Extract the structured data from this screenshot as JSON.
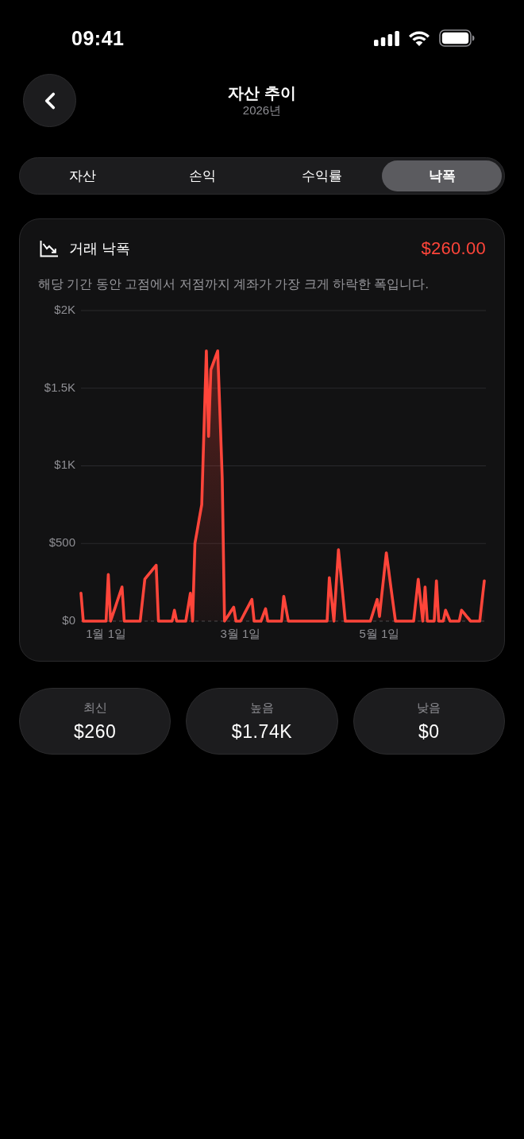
{
  "status_bar": {
    "time": "09:41"
  },
  "header": {
    "title": "자산 추이",
    "subtitle": "2026년"
  },
  "tabs": [
    {
      "label": "자산",
      "selected": false
    },
    {
      "label": "손익",
      "selected": false
    },
    {
      "label": "수익률",
      "selected": false
    },
    {
      "label": "낙폭",
      "selected": true
    }
  ],
  "drawdown_card": {
    "title": "거래 낙폭",
    "value": "$260.00",
    "description": "해당 기간 동안 고점에서 저점까지 계좌가 가장 크게 하락한 폭입니다.",
    "chart_data": {
      "type": "area",
      "grid": true,
      "categories": [
        null,
        null,
        null,
        null,
        null,
        null,
        null,
        null,
        null,
        null,
        null,
        "1월 1일",
        null,
        null,
        null,
        null,
        null,
        null,
        null,
        null,
        null,
        null,
        null,
        null,
        null,
        null,
        null,
        null,
        null,
        null,
        null,
        null,
        null,
        null,
        null,
        null,
        null,
        null,
        null,
        null,
        null,
        null,
        null,
        null,
        null,
        null,
        null,
        null,
        null,
        null,
        null,
        null,
        null,
        null,
        null,
        null,
        null,
        null,
        null,
        null,
        null,
        null,
        null,
        null,
        null,
        null,
        null,
        null,
        null,
        null,
        "3월 1일",
        null,
        null,
        null,
        null,
        null,
        null,
        null,
        null,
        null,
        null,
        null,
        null,
        null,
        null,
        null,
        null,
        null,
        null,
        null,
        null,
        null,
        null,
        null,
        null,
        null,
        null,
        null,
        null,
        null,
        null,
        null,
        null,
        null,
        null,
        null,
        null,
        null,
        null,
        null,
        null,
        null,
        null,
        null,
        null,
        null,
        null,
        null,
        null,
        null,
        null,
        null,
        null,
        null,
        null,
        null,
        null,
        null,
        null,
        null,
        null,
        "5월 1일",
        null,
        null,
        null,
        null,
        null,
        null,
        null,
        null,
        null,
        null,
        null,
        null,
        null,
        null,
        null,
        null,
        null,
        null,
        null,
        null,
        null,
        null,
        null,
        null,
        null,
        null,
        null,
        null,
        null,
        null,
        null,
        null,
        null,
        null,
        null,
        null,
        null,
        null,
        null,
        null,
        null,
        null,
        null,
        null,
        null,
        null
      ],
      "series": [
        {
          "color": "#ff453a",
          "values": [
            180,
            0,
            0,
            0,
            0,
            0,
            0,
            0,
            0,
            0,
            0,
            0,
            300,
            0,
            44,
            88,
            132,
            176,
            220,
            0,
            0,
            0,
            0,
            0,
            0,
            0,
            0,
            135,
            270,
            288,
            306,
            324,
            342,
            360,
            0,
            0,
            0,
            0,
            0,
            0,
            0,
            70,
            0,
            0,
            0,
            0,
            0,
            90,
            180,
            0,
            500,
            583,
            667,
            750,
            1245,
            1740,
            1190,
            1620,
            1660,
            1700,
            1740,
            1330,
            920,
            0,
            23,
            45,
            68,
            90,
            0,
            0,
            0,
            28,
            56,
            84,
            112,
            140,
            0,
            0,
            0,
            0,
            40,
            80,
            0,
            0,
            0,
            0,
            0,
            0,
            0,
            160,
            80,
            0,
            0,
            0,
            0,
            0,
            0,
            0,
            0,
            0,
            0,
            0,
            0,
            0,
            0,
            0,
            0,
            0,
            0,
            280,
            140,
            0,
            230,
            460,
            307,
            153,
            0,
            0,
            0,
            0,
            0,
            0,
            0,
            0,
            0,
            0,
            0,
            0,
            47,
            93,
            140,
            30,
            167,
            303,
            440,
            330,
            220,
            110,
            0,
            0,
            0,
            0,
            0,
            0,
            0,
            0,
            0,
            135,
            270,
            135,
            0,
            220,
            0,
            0,
            0,
            0,
            260,
            0,
            0,
            0,
            70,
            35,
            0,
            0,
            0,
            0,
            0,
            70,
            53,
            35,
            18,
            0,
            0,
            0,
            0,
            0,
            130,
            260
          ]
        }
      ],
      "ylim": [
        0,
        2000
      ],
      "yticks": [
        {
          "value": 0,
          "label": "$0"
        },
        {
          "value": 500,
          "label": "$500"
        },
        {
          "value": 1000,
          "label": "$1K"
        },
        {
          "value": 1500,
          "label": "$1.5K"
        },
        {
          "value": 2000,
          "label": "$2K"
        }
      ]
    }
  },
  "stats": [
    {
      "label": "최신",
      "value": "$260"
    },
    {
      "label": "높음",
      "value": "$1.74K"
    },
    {
      "label": "낮음",
      "value": "$0"
    }
  ]
}
